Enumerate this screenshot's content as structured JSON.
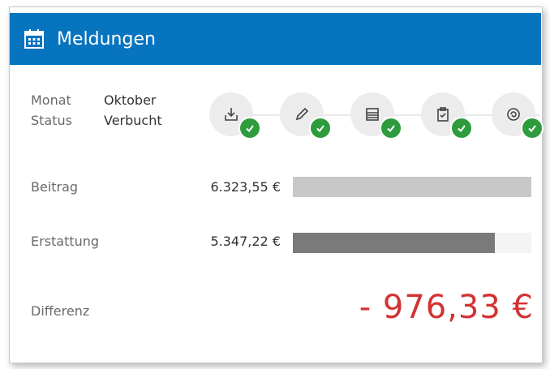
{
  "header": {
    "title": "Meldungen",
    "icon": "calendar-icon",
    "color": "#0774bf"
  },
  "meta": {
    "monat_label": "Monat",
    "monat_value": "Oktober",
    "status_label": "Status",
    "status_value": "Verbucht"
  },
  "steps": [
    {
      "name": "download-icon",
      "done": true
    },
    {
      "name": "pencil-icon",
      "done": true
    },
    {
      "name": "list-icon",
      "done": true
    },
    {
      "name": "clipboard-check-icon",
      "done": true
    },
    {
      "name": "cycle-icon",
      "done": true
    }
  ],
  "beitrag": {
    "label": "Beitrag",
    "amount": "6.323,55 €",
    "fill_fraction": 1.0,
    "color": "#c8c8c8"
  },
  "erstattung": {
    "label": "Erstattung",
    "amount": "5.347,22 €",
    "fill_fraction": 0.846,
    "color": "#7a7a7a"
  },
  "differenz": {
    "label": "Differenz",
    "value": "-  976,33 €",
    "color": "#d23232"
  }
}
